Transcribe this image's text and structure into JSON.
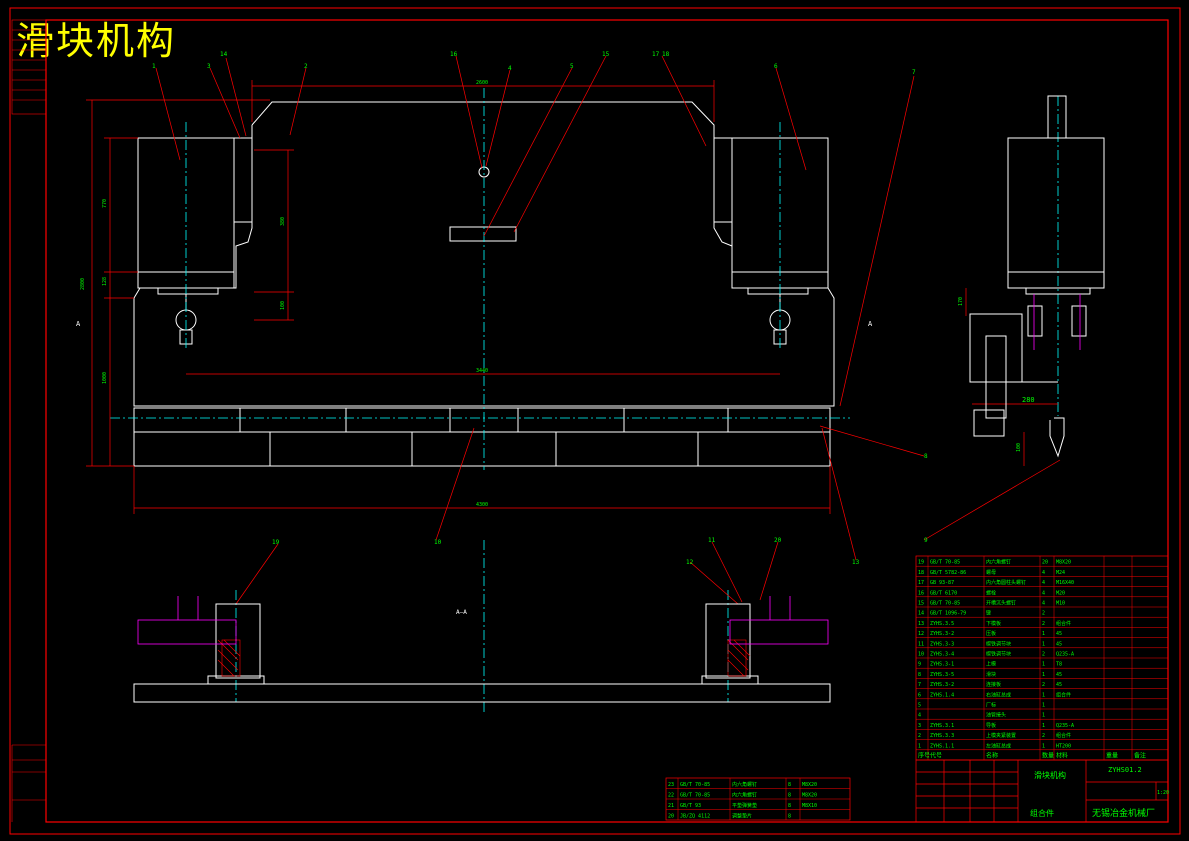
{
  "drawing": {
    "title": "滑块机构",
    "section_label": "A—A",
    "view_marker": "A",
    "balloons": [
      "1",
      "3",
      "14",
      "2",
      "16",
      "4",
      "5",
      "15",
      "17",
      "18",
      "6",
      "7",
      "8",
      "10",
      "19",
      "11",
      "12",
      "20",
      "13",
      "9"
    ],
    "dimensions": {
      "top_width": "2600",
      "left_height_total": "2800",
      "left_upper": "770",
      "left_mid": "128",
      "left_lower": "1000",
      "inner_height": "380",
      "inner_small": "100",
      "cylinder_span": "3440",
      "overall_width": "4300",
      "side_width": "280",
      "side_height": "100",
      "side_small": "170"
    }
  },
  "parts_list": {
    "rows": [
      {
        "no": "19",
        "code": "GB/T 70-85",
        "name": "内六角螺钉",
        "qty": "20",
        "material": "M8X20"
      },
      {
        "no": "18",
        "code": "GB/T 5782-86",
        "name": "螺母",
        "qty": "4",
        "material": "M24"
      },
      {
        "no": "17",
        "code": "GB 93-87",
        "name": "内六角圆柱头螺钉",
        "qty": "4",
        "material": "M16X40"
      },
      {
        "no": "16",
        "code": "GB/T 6170",
        "name": "螺栓",
        "qty": "4",
        "material": "M20"
      },
      {
        "no": "15",
        "code": "GB/T 70-85",
        "name": "开槽沉头螺钉",
        "qty": "4",
        "material": "M10"
      },
      {
        "no": "14",
        "code": "GB/T 1096-79",
        "name": "键",
        "qty": "2",
        "material": ""
      },
      {
        "no": "13",
        "code": "ZYHS.3.5",
        "name": "下模板",
        "qty": "2",
        "material": "组合件"
      },
      {
        "no": "12",
        "code": "ZYHS.3-2",
        "name": "压板",
        "qty": "1",
        "material": "45"
      },
      {
        "no": "11",
        "code": "ZYHS.3-3",
        "name": "楔铁调节块",
        "qty": "1",
        "material": "45"
      },
      {
        "no": "10",
        "code": "ZYHS.3-4",
        "name": "楔铁调节块",
        "qty": "2",
        "material": "Q235-A"
      },
      {
        "no": "9",
        "code": "ZYHS.3-1",
        "name": "上模",
        "qty": "1",
        "material": "T8"
      },
      {
        "no": "8",
        "code": "ZYHS.3-5",
        "name": "滑块",
        "qty": "1",
        "material": "45"
      },
      {
        "no": "7",
        "code": "ZYHS.3-2",
        "name": "连接板",
        "qty": "2",
        "material": "45"
      },
      {
        "no": "6",
        "code": "ZYHS.1.4",
        "name": "右油缸总成",
        "qty": "1",
        "material": "组合件"
      },
      {
        "no": "5",
        "code": "",
        "name": "厂标",
        "qty": "1",
        "material": ""
      },
      {
        "no": "4",
        "code": "",
        "name": "油管接头",
        "qty": "1",
        "material": ""
      },
      {
        "no": "3",
        "code": "ZYHS.3.1",
        "name": "导板",
        "qty": "1",
        "material": "Q235-A"
      },
      {
        "no": "2",
        "code": "ZYHS.3.3",
        "name": "上模夹紧装置",
        "qty": "2",
        "material": "组合件"
      },
      {
        "no": "1",
        "code": "ZYHS.1.1",
        "name": "左油缸总成",
        "qty": "1",
        "material": "HT200"
      }
    ],
    "header": [
      "序号",
      "代号",
      "名称",
      "数量",
      "材料",
      "重量",
      "备注"
    ]
  },
  "extra_list": {
    "rows": [
      {
        "no": "23",
        "code": "GB/T 70-85",
        "name": "内六角螺钉",
        "qty": "8",
        "material": "M8X20"
      },
      {
        "no": "22",
        "code": "GB/T 70-85",
        "name": "内六角螺钉",
        "qty": "8",
        "material": "M8X20"
      },
      {
        "no": "21",
        "code": "GB/T 93",
        "name": "平垫弹簧垫",
        "qty": "8",
        "material": "M8X10"
      },
      {
        "no": "20",
        "code": "JB/ZQ 4112",
        "name": "调整垫片",
        "qty": "8",
        "material": ""
      }
    ]
  },
  "title_block": {
    "part_name": "滑块机构",
    "drawing_no": "ZYHS01.2",
    "scale": "1:20",
    "company": "无锡冶金机械厂",
    "assembly": "组合件"
  },
  "colors": {
    "border": "#ff0000",
    "outline": "#ffffff",
    "center": "#00ffff",
    "dimension": "#ff0000",
    "text": "#00ff00",
    "title": "#ffff00",
    "hidden": "#ff00ff"
  }
}
